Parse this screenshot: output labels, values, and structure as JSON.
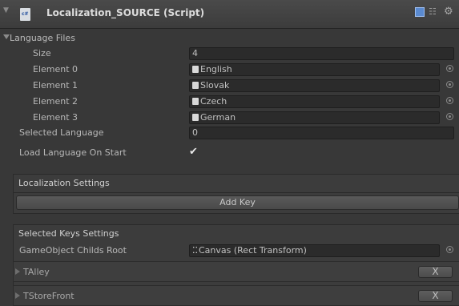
{
  "component": {
    "title": "Localization_SOURCE (Script)",
    "icons": [
      "script-icon",
      "book-icon",
      "settings-icon",
      "gear-icon"
    ]
  },
  "language_files": {
    "label": "Language Files",
    "size_label": "Size",
    "size_value": "4",
    "elements": [
      {
        "label": "Element 0",
        "value": "English"
      },
      {
        "label": "Element 1",
        "value": "Slovak"
      },
      {
        "label": "Element 2",
        "value": "Czech"
      },
      {
        "label": "Element 3",
        "value": "German"
      }
    ]
  },
  "selected_language": {
    "label": "Selected Language",
    "value": "0"
  },
  "load_on_start": {
    "label": "Load Language On Start",
    "checked": true,
    "mark": "✔"
  },
  "localization_settings": {
    "title": "Localization Settings",
    "add_key_label": "Add Key"
  },
  "selected_keys": {
    "title": "Selected Keys Settings",
    "root_label": "GameObject Childs Root",
    "root_value": "Canvas (Rect Transform)"
  },
  "keys": [
    {
      "name": "TAlley",
      "remove_label": "X"
    },
    {
      "name": "TStoreFront",
      "remove_label": "X"
    }
  ],
  "colors": {
    "background": "#383838",
    "field": "#2b2b2b",
    "header": "#4a4a4a"
  }
}
